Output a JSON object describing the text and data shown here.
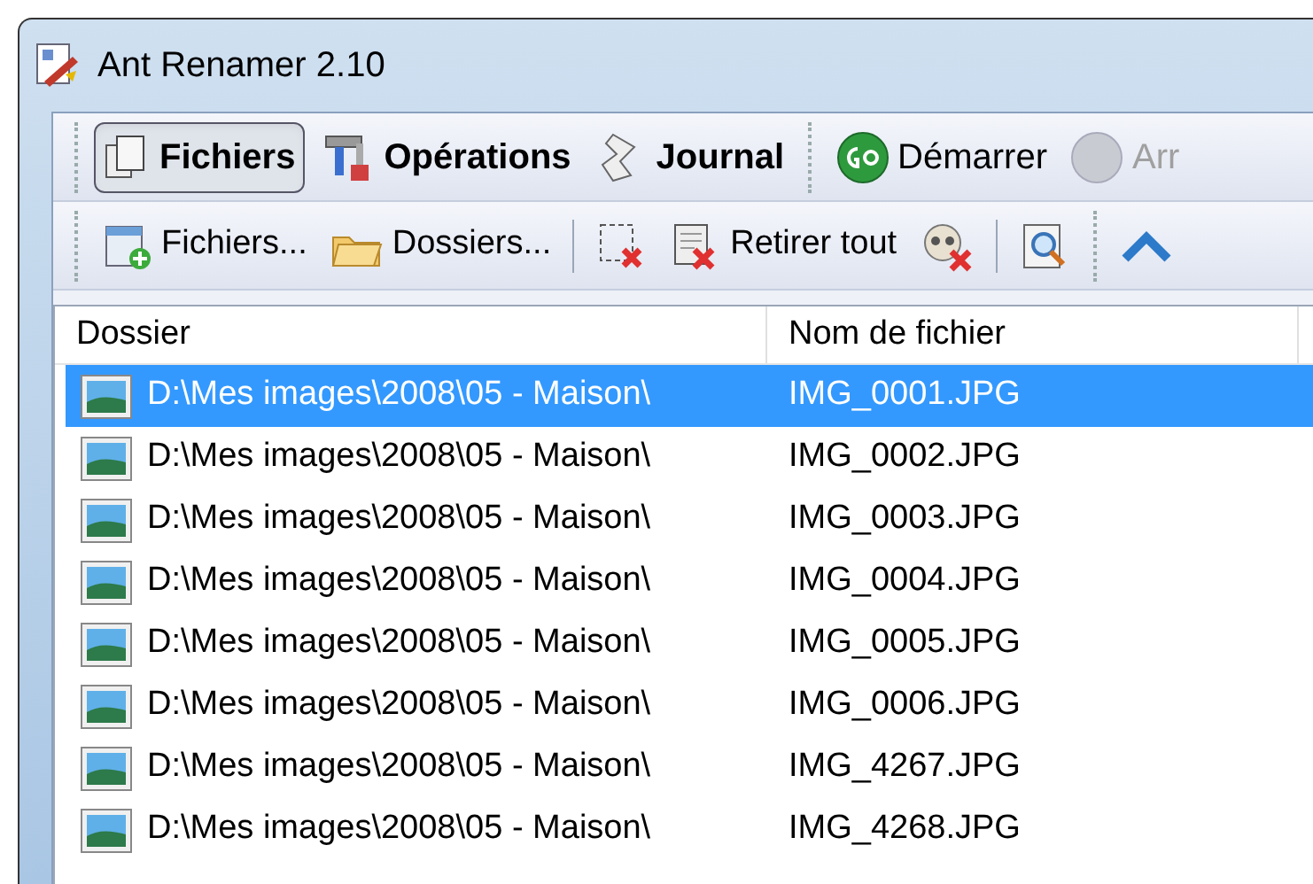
{
  "window": {
    "title": "Ant Renamer 2.10"
  },
  "tabs": [
    {
      "label": "Fichiers",
      "selected": true
    },
    {
      "label": "Opérations",
      "selected": false
    },
    {
      "label": "Journal",
      "selected": false
    }
  ],
  "actions": [
    {
      "label": "Démarrer",
      "disabled": false
    },
    {
      "label": "Arr",
      "disabled": true
    }
  ],
  "toolbar": [
    {
      "kind": "button",
      "label": "Fichiers..."
    },
    {
      "kind": "button",
      "label": "Dossiers..."
    },
    {
      "kind": "separator"
    },
    {
      "kind": "icon"
    },
    {
      "kind": "button",
      "label": "Retirer tout"
    },
    {
      "kind": "icon"
    },
    {
      "kind": "separator"
    },
    {
      "kind": "icon"
    },
    {
      "kind": "grip"
    },
    {
      "kind": "icon"
    }
  ],
  "table": {
    "columns": [
      "Dossier",
      "Nom de fichier"
    ],
    "rows": [
      {
        "folder": "D:\\Mes images\\2008\\05 - Maison\\",
        "file": "IMG_0001.JPG",
        "selected": true
      },
      {
        "folder": "D:\\Mes images\\2008\\05 - Maison\\",
        "file": "IMG_0002.JPG",
        "selected": false
      },
      {
        "folder": "D:\\Mes images\\2008\\05 - Maison\\",
        "file": "IMG_0003.JPG",
        "selected": false
      },
      {
        "folder": "D:\\Mes images\\2008\\05 - Maison\\",
        "file": "IMG_0004.JPG",
        "selected": false
      },
      {
        "folder": "D:\\Mes images\\2008\\05 - Maison\\",
        "file": "IMG_0005.JPG",
        "selected": false
      },
      {
        "folder": "D:\\Mes images\\2008\\05 - Maison\\",
        "file": "IMG_0006.JPG",
        "selected": false
      },
      {
        "folder": "D:\\Mes images\\2008\\05 - Maison\\",
        "file": "IMG_4267.JPG",
        "selected": false
      },
      {
        "folder": "D:\\Mes images\\2008\\05 - Maison\\",
        "file": "IMG_4268.JPG",
        "selected": false
      }
    ]
  }
}
